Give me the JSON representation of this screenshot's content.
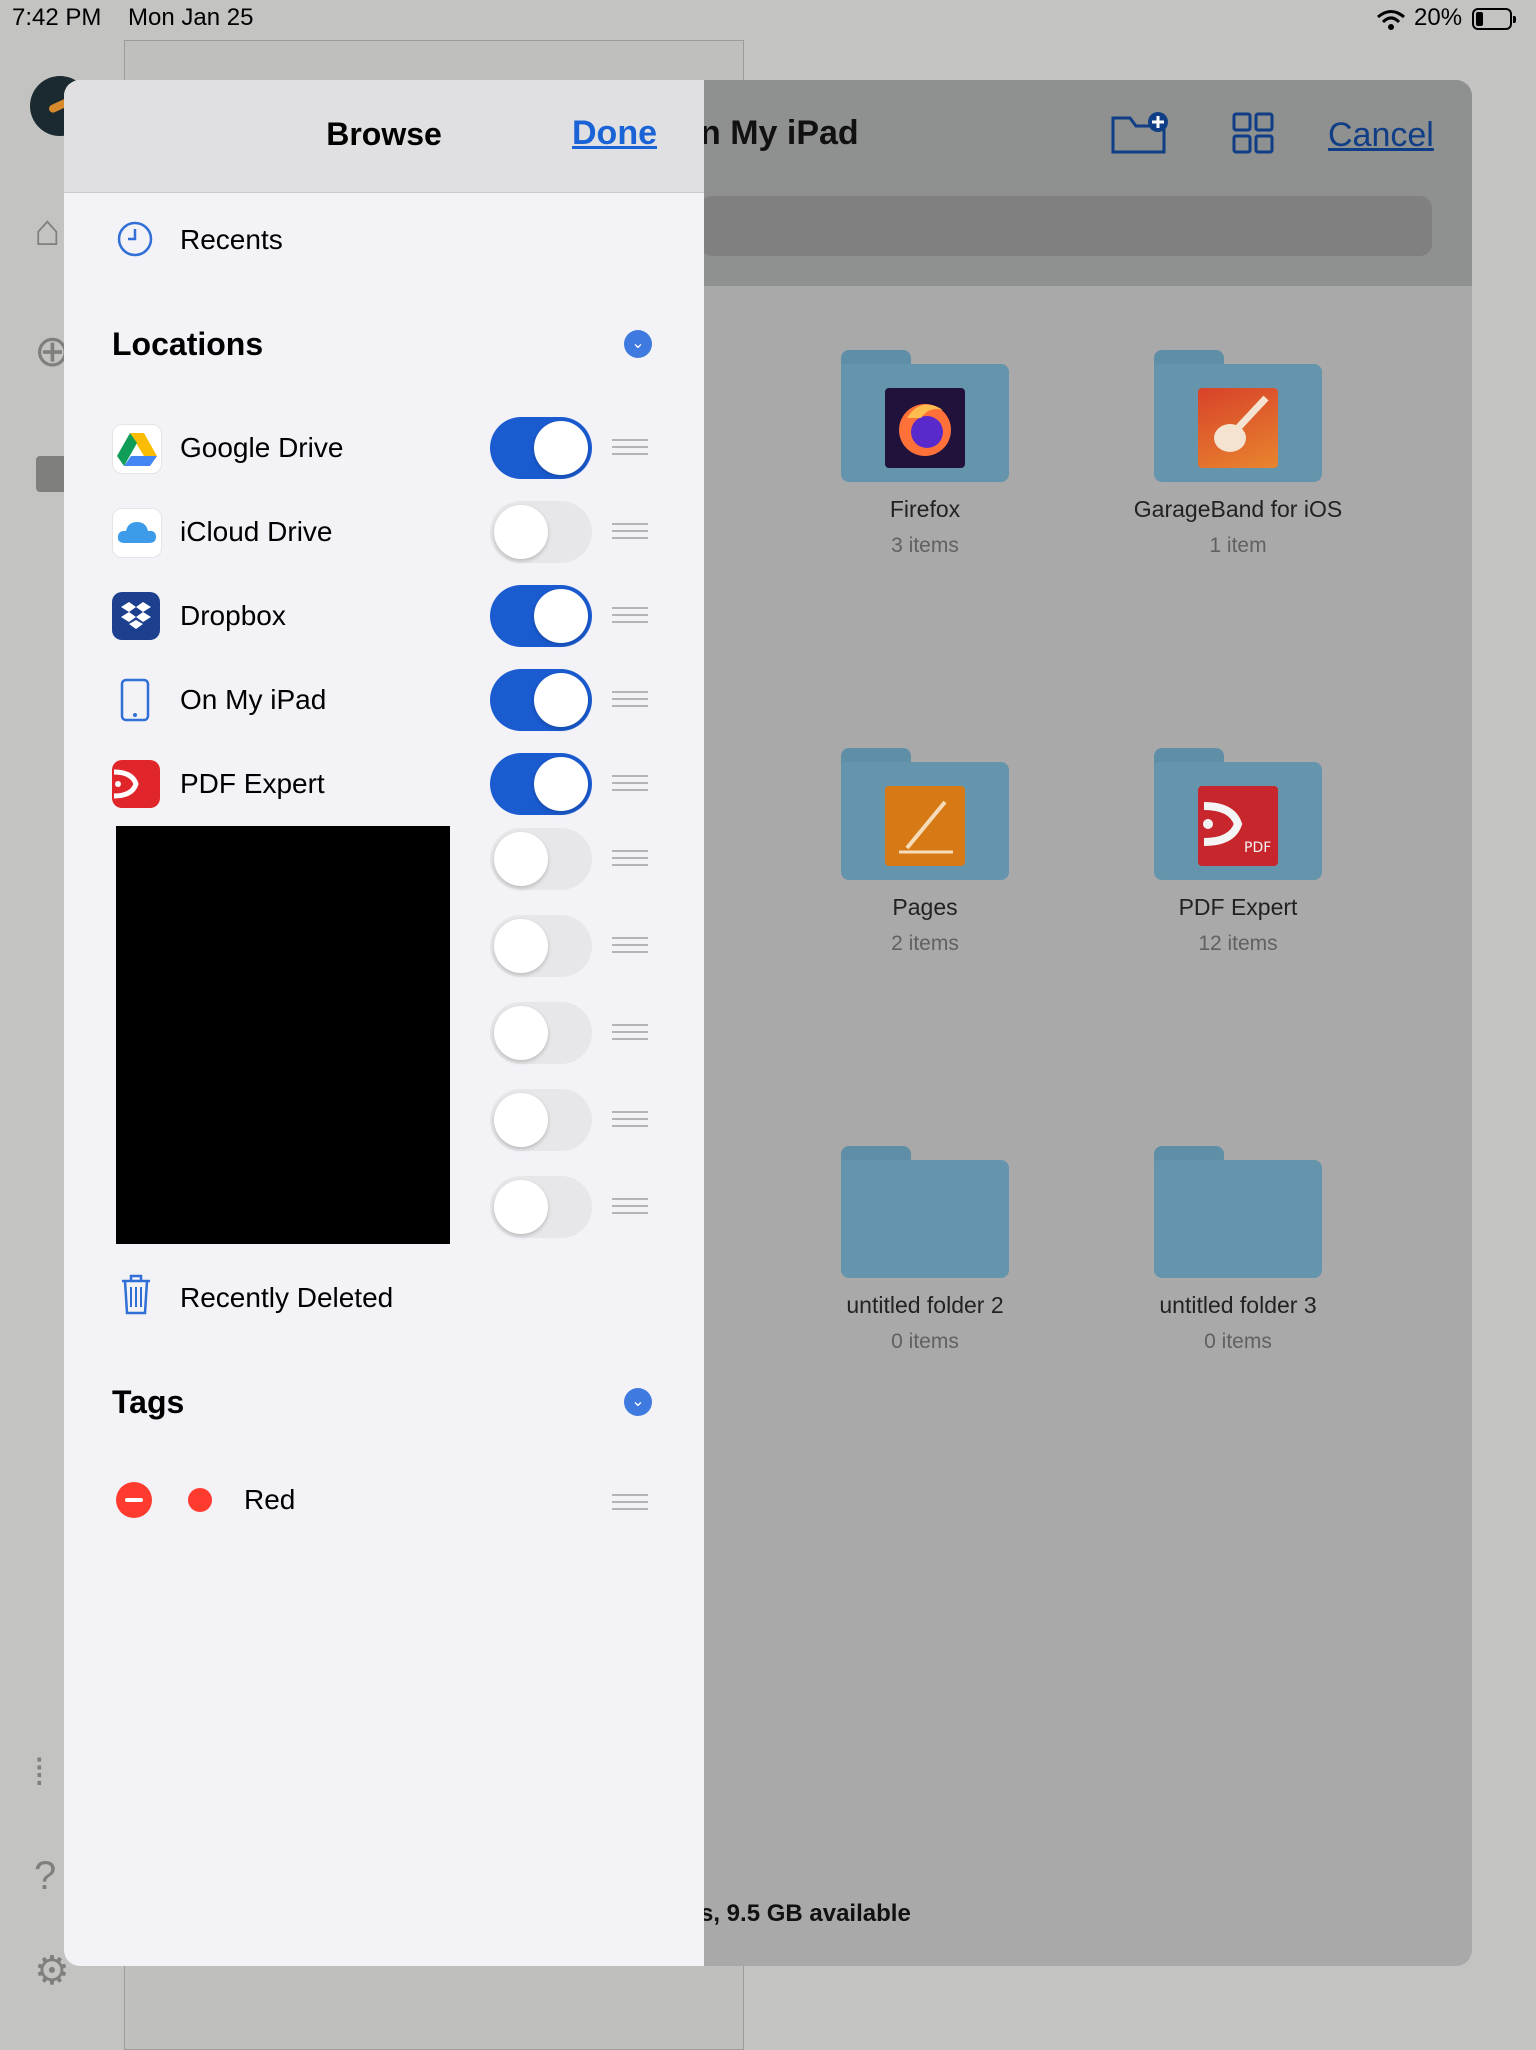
{
  "status_bar": {
    "time": "7:42 PM",
    "date": "Mon Jan 25",
    "battery": "20%"
  },
  "files_sheet": {
    "title": "n My iPad",
    "cancel_label": "Cancel",
    "footer": "s, 9.5 GB available",
    "folders": [
      {
        "name": "Firefox",
        "count": "3 items"
      },
      {
        "name": "GarageBand for iOS",
        "count": "1 item"
      },
      {
        "name": "Pages",
        "count": "2 items"
      },
      {
        "name": "PDF Expert",
        "count": "12 items"
      },
      {
        "name": "untitled folder 2",
        "count": "0 items"
      },
      {
        "name": "untitled folder 3",
        "count": "0 items"
      }
    ]
  },
  "browse": {
    "title": "Browse",
    "done_label": "Done",
    "recents_label": "Recents",
    "locations_heading": "Locations",
    "locations": [
      {
        "label": "Google Drive",
        "enabled": true
      },
      {
        "label": "iCloud Drive",
        "enabled": false
      },
      {
        "label": "Dropbox",
        "enabled": true
      },
      {
        "label": "On My iPad",
        "enabled": true
      },
      {
        "label": "PDF Expert",
        "enabled": true
      }
    ],
    "hidden_locations_enabled": [
      false,
      false,
      false,
      false,
      false
    ],
    "recently_deleted_label": "Recently Deleted",
    "tags_heading": "Tags",
    "tags": [
      {
        "label": "Red",
        "color": "#ff3b30"
      }
    ]
  },
  "colors": {
    "accent": "#1a5bd0",
    "link": "#1a63d6",
    "folder": "#6495ad"
  }
}
